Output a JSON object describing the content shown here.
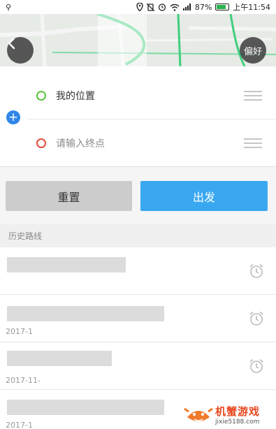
{
  "status_bar": {
    "usb_icon": "usb-icon",
    "battery": "87%",
    "battery_level": 0.87,
    "time": "上午11:54"
  },
  "map": {
    "back_icon": "back-arrow-icon",
    "preference_label": "偏好",
    "road_color": "#3fcf7c"
  },
  "route": {
    "start_label": "我的位置",
    "end_placeholder": "请输入终点",
    "start_color": "#5cc441",
    "end_color": "#e34b3f",
    "swap_icon": "plus-icon"
  },
  "actions": {
    "reset_label": "重置",
    "go_label": "出发",
    "go_color": "#3aa8f0"
  },
  "history": {
    "header": "历史路线",
    "items": [
      {
        "date": ""
      },
      {
        "date": "2017-1"
      },
      {
        "date": "2017-11-"
      },
      {
        "date": "2017-1"
      }
    ]
  },
  "watermark": {
    "title": "机蟹游戏",
    "url": "jixie5188.com"
  }
}
